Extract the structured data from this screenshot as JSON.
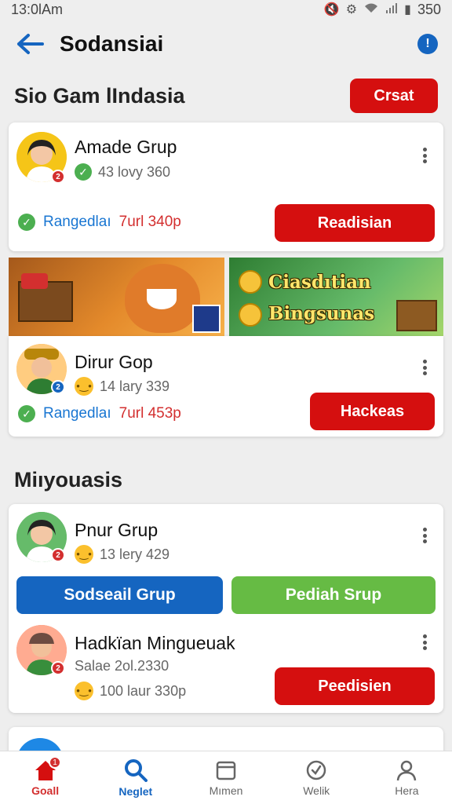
{
  "status_bar": {
    "time": "13:0lAm",
    "battery": "350"
  },
  "app_bar": {
    "title": "Sodansiai"
  },
  "section1": {
    "title": "Sio Gam lIndasia",
    "create_label": "Crsat"
  },
  "cards": [
    {
      "name": "Amade Grup",
      "meta": "43 lovy 360",
      "range_label": "Rangedlaı",
      "range_value": "7url 340p",
      "button": "Readisian"
    },
    {
      "name": "Dirur Gop",
      "meta": "14 lary 339",
      "range_label": "Rangedlaı",
      "range_value": "7url 453p",
      "button": "Hackeas"
    }
  ],
  "banner": {
    "line1": "Ciasdıtian",
    "line2": "Bingsunas"
  },
  "section2": {
    "title": "Miıyouasis"
  },
  "card3": {
    "name": "Pnur Grup",
    "meta": "13 lery 429",
    "btn_left": "Sodseail Grup",
    "btn_right": "Pediah Srup"
  },
  "card4": {
    "name": "Hadkïan Mingueuak",
    "sub": "Salae 2ol.2330",
    "meta": "100 laur 330p",
    "button": "Peedisien"
  },
  "bottom_nav": [
    {
      "label": "Goall",
      "icon": "home-icon",
      "badge": "1"
    },
    {
      "label": "Neglet",
      "icon": "search-icon"
    },
    {
      "label": "Mımen",
      "icon": "calendar-icon"
    },
    {
      "label": "Welik",
      "icon": "check-circle-icon"
    },
    {
      "label": "Hera",
      "icon": "person-icon"
    }
  ],
  "colors": {
    "accent_red": "#d50f0f",
    "accent_blue": "#1565c0",
    "accent_green": "#66bb44",
    "check_green": "#4caf50"
  }
}
